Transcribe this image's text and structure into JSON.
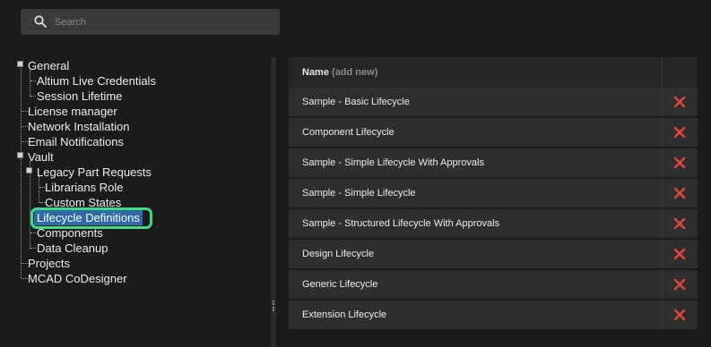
{
  "search": {
    "placeholder": "Search",
    "icon": "search-icon"
  },
  "tree": {
    "items": [
      {
        "label": "General"
      },
      {
        "label": "Altium Live Credentials"
      },
      {
        "label": "Session Lifetime"
      },
      {
        "label": "License manager"
      },
      {
        "label": "Network Installation"
      },
      {
        "label": "Email Notifications"
      },
      {
        "label": "Vault"
      },
      {
        "label": "Legacy Part Requests"
      },
      {
        "label": "Librarians Role"
      },
      {
        "label": "Custom States"
      },
      {
        "label": "Lifecycle Definitions"
      },
      {
        "label": "Components"
      },
      {
        "label": "Data Cleanup"
      },
      {
        "label": "Projects"
      },
      {
        "label": "MCAD CoDesigner"
      }
    ],
    "selected": "Lifecycle Definitions"
  },
  "table": {
    "header": {
      "name": "Name",
      "add": "(add new)"
    },
    "rows": [
      {
        "name": "Sample - Basic Lifecycle"
      },
      {
        "name": "Component Lifecycle"
      },
      {
        "name": "Sample - Simple Lifecycle With Approvals"
      },
      {
        "name": "Sample - Simple Lifecycle"
      },
      {
        "name": "Sample - Structured Lifecycle With Approvals"
      },
      {
        "name": "Design Lifecycle"
      },
      {
        "name": "Generic Lifecycle"
      },
      {
        "name": "Extension Lifecycle"
      }
    ],
    "delete_icon": "delete-x-icon",
    "delete_color": "#e0443e"
  },
  "colors": {
    "selection": "#2f6aa8",
    "highlight_ring": "#3ddc84"
  }
}
